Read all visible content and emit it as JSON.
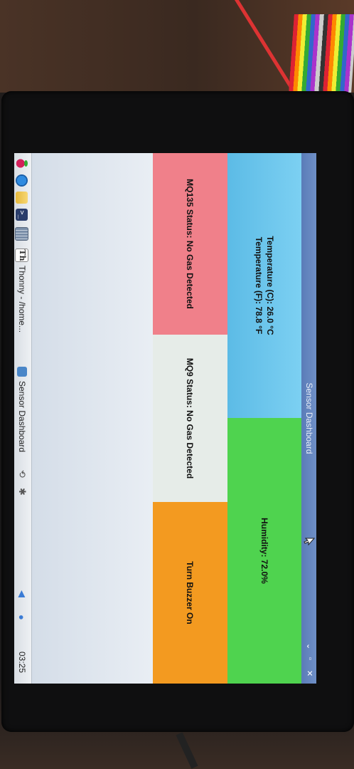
{
  "window": {
    "title": "Sensor Dashboard",
    "controls": [
      "⌄",
      "▫",
      "✕"
    ]
  },
  "panels": {
    "temperature_c": "Temperature (C): 26.0 °C",
    "temperature_f": "Temperature (F): 78.8 °F",
    "humidity": "Humidity: 72.0%",
    "mq135": "MQ135 Status: No Gas Detected",
    "mq9": "MQ9 Status: No Gas Detected",
    "buzzer_button": "Turn Buzzer On"
  },
  "taskbar": {
    "thonny": "Thonny - /home...",
    "dashboard": "Sensor Dashboard",
    "clock": "03:25",
    "term_glyph": ">_"
  },
  "colors": {
    "title_bar": "#5a7cb8",
    "temperature_bg": "#6ac4ec",
    "humidity_bg": "#4fd34f",
    "mq135_bg": "#f0808a",
    "mq9_bg": "#e6ece8",
    "buzzer_bg": "#f39a20"
  }
}
